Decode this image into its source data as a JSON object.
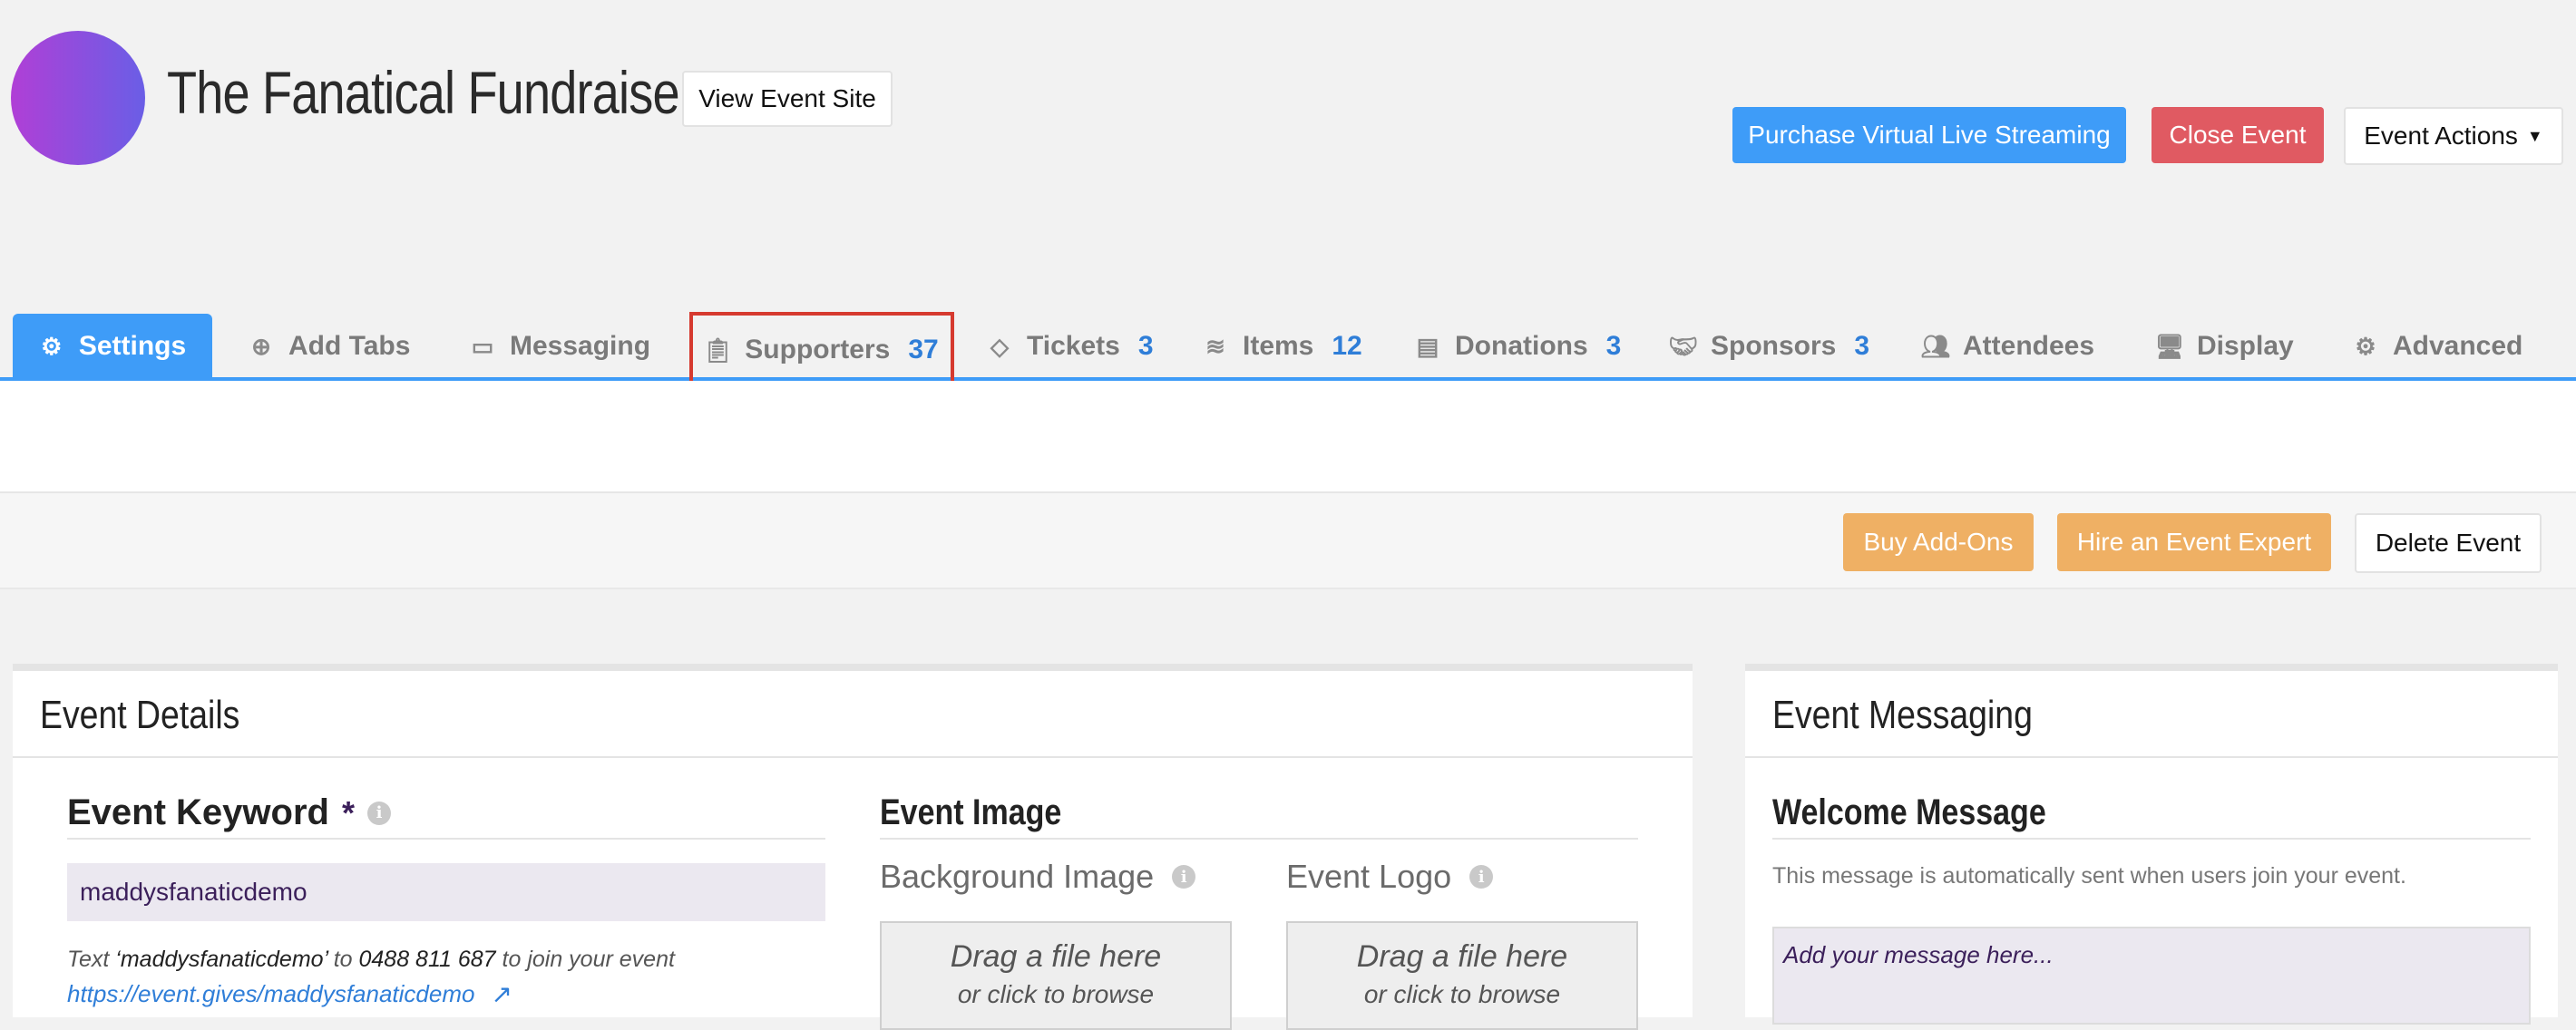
{
  "header": {
    "title": "The Fanatical Fundraiser",
    "view_site": "View Event Site",
    "purchase_streaming": "Purchase Virtual Live Streaming",
    "close_event": "Close Event",
    "event_actions": "Event Actions"
  },
  "tabs": [
    {
      "label": "Settings",
      "icon": "gear-icon"
    },
    {
      "label": "Add Tabs",
      "icon": "plus-circle-icon"
    },
    {
      "label": "Messaging",
      "icon": "inbox-icon"
    },
    {
      "label": "Supporters",
      "count": "37",
      "icon": "clipboard-icon"
    },
    {
      "label": "Tickets",
      "count": "3",
      "icon": "ticket-icon"
    },
    {
      "label": "Items",
      "count": "12",
      "icon": "layers-icon"
    },
    {
      "label": "Donations",
      "count": "3",
      "icon": "receipt-icon"
    },
    {
      "label": "Sponsors",
      "count": "3",
      "icon": "handshake-icon"
    },
    {
      "label": "Attendees",
      "icon": "users-icon"
    },
    {
      "label": "Display",
      "icon": "monitor-icon"
    },
    {
      "label": "Advanced",
      "icon": "gears-icon"
    }
  ],
  "actions": {
    "buy_addons": "Buy Add-Ons",
    "hire_expert": "Hire an Event Expert",
    "delete_event": "Delete Event"
  },
  "event_details": {
    "heading": "Event Details",
    "keyword_label": "Event Keyword",
    "required_mark": "*",
    "keyword_value": "maddysfanaticdemo",
    "help_text_pre": "Text ",
    "help_keyword": "‘maddysfanaticdemo’",
    "help_to": " to ",
    "help_number": "0488 811 687",
    "help_post": " to join your event",
    "event_link": "https://event.gives/maddysfanaticdemo",
    "image_heading": "Event Image",
    "background_label": "Background Image",
    "logo_label": "Event Logo",
    "drop_line1": "Drag a file here",
    "drop_line2": "or click to browse"
  },
  "event_messaging": {
    "heading": "Event Messaging",
    "welcome_heading": "Welcome Message",
    "welcome_desc": "This message is automatically sent when users join your event.",
    "placeholder": "Add your message here..."
  },
  "colors": {
    "accent": "#3e9cf8",
    "danger": "#e05a62",
    "warning": "#efb064",
    "highlight": "#d63a2f"
  }
}
